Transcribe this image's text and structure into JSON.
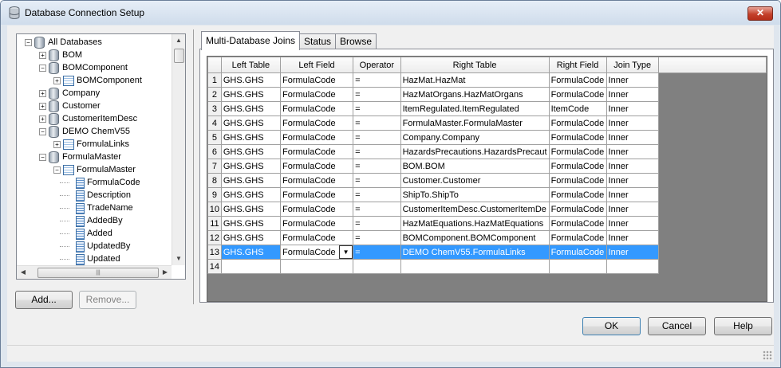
{
  "window": {
    "title": "Database Connection Setup",
    "close_label": "✕"
  },
  "tree": {
    "items": [
      {
        "label": "All Databases",
        "level": 0,
        "kind": "root",
        "expanded": true
      },
      {
        "label": "BOM",
        "level": 1,
        "kind": "db",
        "expanded": false
      },
      {
        "label": "BOMComponent",
        "level": 1,
        "kind": "db",
        "expanded": true
      },
      {
        "label": "BOMComponent",
        "level": 2,
        "kind": "table",
        "expanded": false
      },
      {
        "label": "Company",
        "level": 1,
        "kind": "db",
        "expanded": false
      },
      {
        "label": "Customer",
        "level": 1,
        "kind": "db",
        "expanded": false
      },
      {
        "label": "CustomerItemDesc",
        "level": 1,
        "kind": "db",
        "expanded": false
      },
      {
        "label": "DEMO ChemV55",
        "level": 1,
        "kind": "db",
        "expanded": true
      },
      {
        "label": "FormulaLinks",
        "level": 2,
        "kind": "table",
        "expanded": false
      },
      {
        "label": "FormulaMaster",
        "level": 1,
        "kind": "db",
        "expanded": true
      },
      {
        "label": "FormulaMaster",
        "level": 2,
        "kind": "table",
        "expanded": true
      },
      {
        "label": "FormulaCode",
        "level": 3,
        "kind": "field"
      },
      {
        "label": "Description",
        "level": 3,
        "kind": "field"
      },
      {
        "label": "TradeName",
        "level": 3,
        "kind": "field"
      },
      {
        "label": "AddedBy",
        "level": 3,
        "kind": "field"
      },
      {
        "label": "Added",
        "level": 3,
        "kind": "field"
      },
      {
        "label": "UpdatedBy",
        "level": 3,
        "kind": "field"
      },
      {
        "label": "Updated",
        "level": 3,
        "kind": "field"
      }
    ]
  },
  "buttons": {
    "add": "Add...",
    "remove": "Remove...",
    "ok": "OK",
    "cancel": "Cancel",
    "help": "Help"
  },
  "tabs": [
    {
      "label": "Multi-Database Joins",
      "active": true
    },
    {
      "label": "Status",
      "active": false
    },
    {
      "label": "Browse",
      "active": false
    }
  ],
  "grid": {
    "columns": [
      "Left Table",
      "Left Field",
      "Operator",
      "Right Table",
      "Right Field",
      "Join Type"
    ],
    "rows": [
      [
        "GHS.GHS",
        "FormulaCode",
        "=",
        "HazMat.HazMat",
        "FormulaCode",
        "Inner"
      ],
      [
        "GHS.GHS",
        "FormulaCode",
        "=",
        "HazMatOrgans.HazMatOrgans",
        "FormulaCode",
        "Inner"
      ],
      [
        "GHS.GHS",
        "FormulaCode",
        "=",
        "ItemRegulated.ItemRegulated",
        "ItemCode",
        "Inner"
      ],
      [
        "GHS.GHS",
        "FormulaCode",
        "=",
        "FormulaMaster.FormulaMaster",
        "FormulaCode",
        "Inner"
      ],
      [
        "GHS.GHS",
        "FormulaCode",
        "=",
        "Company.Company",
        "FormulaCode",
        "Inner"
      ],
      [
        "GHS.GHS",
        "FormulaCode",
        "=",
        "HazardsPrecautions.HazardsPrecaut",
        "FormulaCode",
        "Inner"
      ],
      [
        "GHS.GHS",
        "FormulaCode",
        "=",
        "BOM.BOM",
        "FormulaCode",
        "Inner"
      ],
      [
        "GHS.GHS",
        "FormulaCode",
        "=",
        "Customer.Customer",
        "FormulaCode",
        "Inner"
      ],
      [
        "GHS.GHS",
        "FormulaCode",
        "=",
        "ShipTo.ShipTo",
        "FormulaCode",
        "Inner"
      ],
      [
        "GHS.GHS",
        "FormulaCode",
        "=",
        "CustomerItemDesc.CustomerItemDe",
        "FormulaCode",
        "Inner"
      ],
      [
        "GHS.GHS",
        "FormulaCode",
        "=",
        "HazMatEquations.HazMatEquations",
        "FormulaCode",
        "Inner"
      ],
      [
        "GHS.GHS",
        "FormulaCode",
        "=",
        "BOMComponent.BOMComponent",
        "FormulaCode",
        "Inner"
      ],
      [
        "GHS.GHS",
        "FormulaCode",
        "=",
        "DEMO ChemV55.FormulaLinks",
        "FormulaCode",
        "Inner"
      ],
      [
        "",
        "",
        "",
        "",
        "",
        ""
      ]
    ],
    "row_numbers": [
      "1",
      "2",
      "3",
      "4",
      "5",
      "6",
      "7",
      "8",
      "9",
      "10",
      "11",
      "12",
      "13",
      "14"
    ],
    "selected_row_number": "13",
    "selection_color": "#3399ff"
  }
}
